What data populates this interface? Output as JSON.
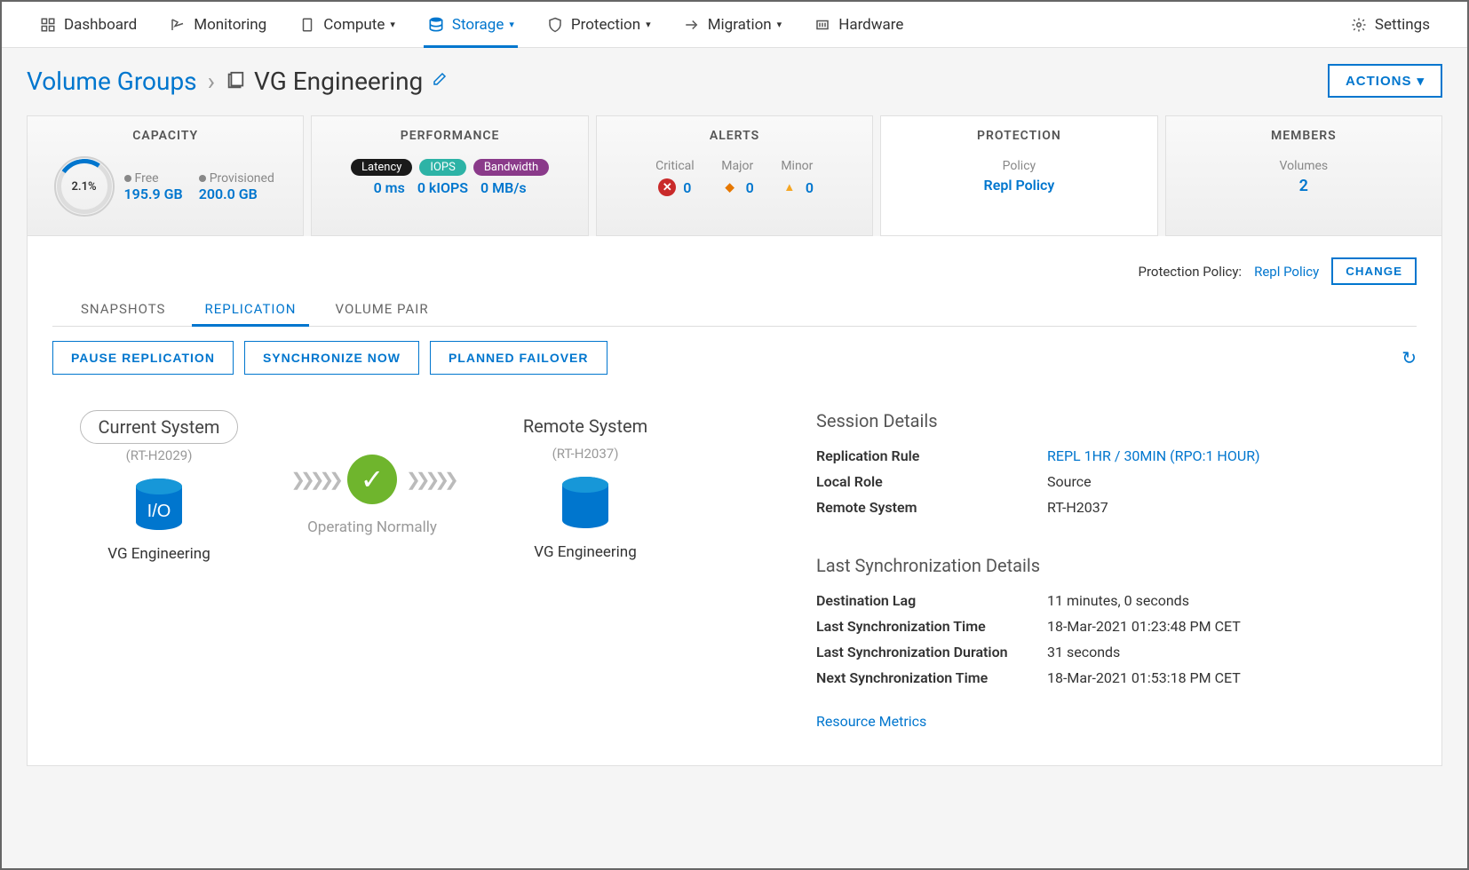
{
  "nav": {
    "items": [
      {
        "label": "Dashboard",
        "icon": "dashboard"
      },
      {
        "label": "Monitoring",
        "icon": "monitoring"
      },
      {
        "label": "Compute",
        "icon": "compute",
        "dropdown": true
      },
      {
        "label": "Storage",
        "icon": "storage",
        "dropdown": true,
        "active": true
      },
      {
        "label": "Protection",
        "icon": "protection",
        "dropdown": true
      },
      {
        "label": "Migration",
        "icon": "migration",
        "dropdown": true
      },
      {
        "label": "Hardware",
        "icon": "hardware"
      }
    ],
    "settings": "Settings"
  },
  "breadcrumb": {
    "root": "Volume Groups",
    "current": "VG Engineering"
  },
  "actions_label": "ACTIONS",
  "cards": {
    "capacity": {
      "title": "CAPACITY",
      "used_pct": "2.1%",
      "free_label": "Free",
      "free_val": "195.9 GB",
      "prov_label": "Provisioned",
      "prov_val": "200.0 GB"
    },
    "performance": {
      "title": "PERFORMANCE",
      "latency_label": "Latency",
      "iops_label": "IOPS",
      "bw_label": "Bandwidth",
      "latency_val": "0 ms",
      "iops_val": "0 kIOPS",
      "bw_val": "0 MB/s"
    },
    "alerts": {
      "title": "ALERTS",
      "critical_label": "Critical",
      "critical_val": "0",
      "major_label": "Major",
      "major_val": "0",
      "minor_label": "Minor",
      "minor_val": "0"
    },
    "protection": {
      "title": "PROTECTION",
      "policy_label": "Policy",
      "policy_val": "Repl Policy"
    },
    "members": {
      "title": "MEMBERS",
      "volumes_label": "Volumes",
      "volumes_val": "2"
    }
  },
  "policy_row": {
    "label": "Protection Policy: ",
    "value": "Repl Policy",
    "change": "CHANGE"
  },
  "subtabs": [
    "SNAPSHOTS",
    "REPLICATION",
    "VOLUME PAIR"
  ],
  "active_subtab": "REPLICATION",
  "action_buttons": [
    "PAUSE REPLICATION",
    "SYNCHRONIZE NOW",
    "PLANNED FAILOVER"
  ],
  "diagram": {
    "current": {
      "title": "Current System",
      "system": "(RT-H2029)",
      "io": "I/O",
      "name": "VG Engineering"
    },
    "status": "Operating Normally",
    "remote": {
      "title": "Remote System",
      "system": "(RT-H2037)",
      "name": "VG Engineering"
    }
  },
  "session": {
    "title": "Session Details",
    "rows": [
      {
        "k": "Replication Rule",
        "v": "REPL 1HR / 30MIN (RPO:1 HOUR)",
        "link": true
      },
      {
        "k": "Local Role",
        "v": "Source"
      },
      {
        "k": "Remote System",
        "v": "RT-H2037"
      }
    ]
  },
  "lastsync": {
    "title": "Last Synchronization Details",
    "rows": [
      {
        "k": "Destination Lag",
        "v": "11 minutes, 0 seconds"
      },
      {
        "k": "Last Synchronization Time",
        "v": "18-Mar-2021 01:23:48 PM CET"
      },
      {
        "k": "Last Synchronization Duration",
        "v": "31 seconds"
      },
      {
        "k": "Next Synchronization Time",
        "v": "18-Mar-2021 01:53:18 PM CET"
      }
    ]
  },
  "resource_metrics": "Resource Metrics"
}
